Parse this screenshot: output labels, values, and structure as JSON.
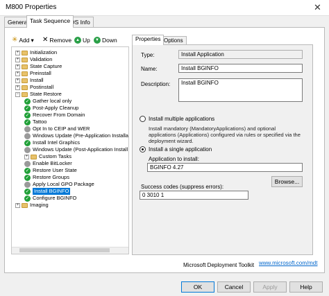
{
  "window": {
    "title": "M800 Properties",
    "close_glyph": "✕"
  },
  "tabs": [
    "General",
    "Task Sequence",
    "OS Info"
  ],
  "toolbar": {
    "add": "Add",
    "remove": "Remove",
    "up": "Up",
    "down": "Down",
    "add_glyph": "✳",
    "remove_glyph": "✕",
    "up_glyph": "▲",
    "down_glyph": "▼",
    "dropdown_glyph": "▾"
  },
  "tree": [
    {
      "label": "Initialization",
      "icon": "folder",
      "expander": "+"
    },
    {
      "label": "Validation",
      "icon": "folder",
      "expander": "+"
    },
    {
      "label": "State Capture",
      "icon": "folder",
      "expander": "+"
    },
    {
      "label": "Preinstall",
      "icon": "folder",
      "expander": "+"
    },
    {
      "label": "Install",
      "icon": "folder",
      "expander": "+"
    },
    {
      "label": "Postinstall",
      "icon": "folder",
      "expander": "+"
    },
    {
      "label": "State Restore",
      "icon": "folder",
      "expander": "−"
    },
    {
      "label": "Gather local only",
      "icon": "check"
    },
    {
      "label": "Post-Apply Cleanup",
      "icon": "check"
    },
    {
      "label": "Recover From Domain",
      "icon": "check"
    },
    {
      "label": "Tattoo",
      "icon": "check"
    },
    {
      "label": "Opt In to CEIP and WER",
      "icon": "gray"
    },
    {
      "label": "Windows Update (Pre-Application Installa",
      "icon": "gray"
    },
    {
      "label": "Install Intel Graphics",
      "icon": "check"
    },
    {
      "label": "Windows Update (Post-Application Install",
      "icon": "gray"
    },
    {
      "label": "Custom Tasks",
      "icon": "folder",
      "expander": "+"
    },
    {
      "label": "Enable BitLocker",
      "icon": "gray"
    },
    {
      "label": "Restore User State",
      "icon": "check"
    },
    {
      "label": "Restore Groups",
      "icon": "check"
    },
    {
      "label": "Apply Local GPO Package",
      "icon": "gray"
    },
    {
      "label": "Install BGINFO",
      "icon": "check",
      "selected": true
    },
    {
      "label": "Configure BGINFO",
      "icon": "check"
    },
    {
      "label": "Imaging",
      "icon": "folder",
      "expander": "+"
    }
  ],
  "right_tabs": [
    "Properties",
    "Options"
  ],
  "properties": {
    "type_label": "Type:",
    "type_value": "Install Application",
    "name_label": "Name:",
    "name_value": "Install BGINFO",
    "description_label": "Description:",
    "description_value": "Install BGINFO",
    "radio_multiple": "Install multiple applications",
    "multiple_desc": "Install mandatory (MandatoryApplications) and optional applications (Applications) configured via rules or specified via the deployment wizard.",
    "radio_single": "Install a single application",
    "app_label": "Application to install:",
    "app_value": "BGINFO 4.27",
    "browse": "Browse...",
    "success_label": "Success codes (suppress errors):",
    "success_value": "0 3010 1"
  },
  "footer": {
    "brand": "Microsoft Deployment Toolkit",
    "link": "www.microsoft.com/mdt"
  },
  "buttons": {
    "ok": "OK",
    "cancel": "Cancel",
    "apply": "Apply",
    "help": "Help"
  }
}
